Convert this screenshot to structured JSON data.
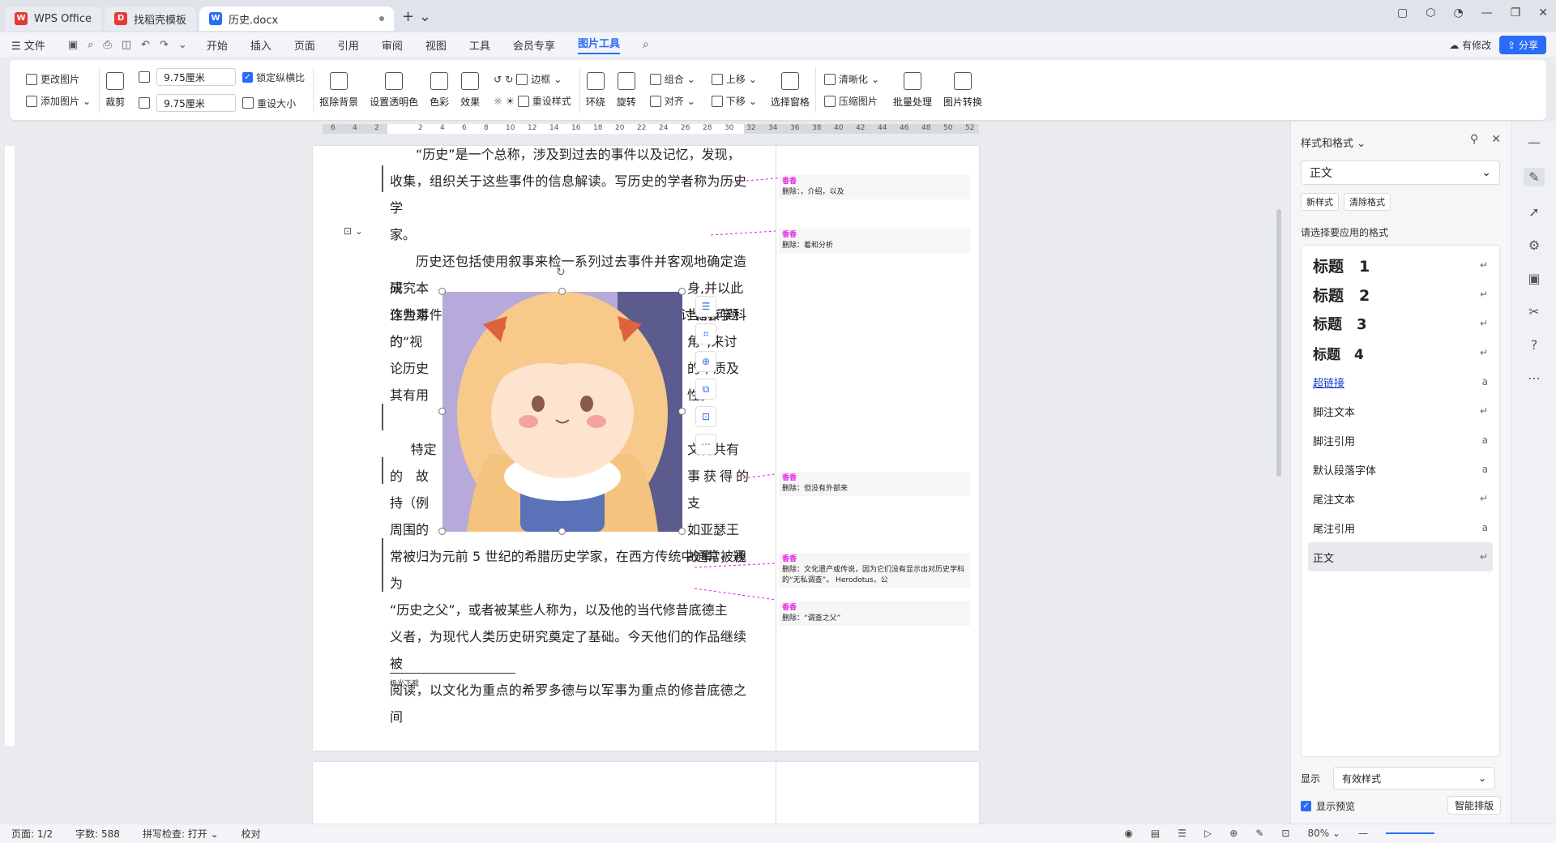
{
  "tabs": [
    {
      "label": "WPS Office",
      "icon": "wps-logo-icon"
    },
    {
      "label": "找稻壳模板",
      "icon": "template-logo-icon"
    },
    {
      "label": "历史.docx",
      "icon": "word-doc-icon"
    }
  ],
  "menu": {
    "file": "文件",
    "items": [
      "开始",
      "插入",
      "页面",
      "引用",
      "审阅",
      "视图",
      "工具",
      "会员专享",
      "图片工具"
    ],
    "active": "图片工具",
    "modify": "有修改",
    "share": "分享"
  },
  "ribbon": {
    "change_image": "更改图片",
    "add_image": "添加图片",
    "crop": "裁剪",
    "height_value": "9.75厘米",
    "width_value": "9.75厘米",
    "lock_ratio": "锁定纵横比",
    "reset_size": "重设大小",
    "remove_bg": "抠除背景",
    "set_transparent": "设置透明色",
    "color": "色彩",
    "effects": "效果",
    "border": "边框",
    "reset_style": "重设样式",
    "wrap": "环绕",
    "rotate": "旋转",
    "group": "组合",
    "align": "对齐",
    "bring_up": "上移",
    "send_down": "下移",
    "selection_pane": "选择窗格",
    "sharpen": "清晰化",
    "compress": "压缩图片",
    "batch": "批量处理",
    "convert": "图片转换"
  },
  "ruler_ticks": [
    "6",
    "4",
    "2",
    "",
    "2",
    "4",
    "6",
    "8",
    "10",
    "12",
    "14",
    "16",
    "18",
    "20",
    "22",
    "24",
    "26",
    "28",
    "30",
    "32",
    "34",
    "36",
    "38",
    "40",
    "42",
    "44",
    "46",
    "48",
    "50",
    "52"
  ],
  "document": {
    "para1_line1": "“历史”是一个总称，涉及到过去的事件以及记忆，发现，",
    "para1_line2": "收集，组织关于这些事件的信息解读。写历史的学者称为历史学",
    "para1_line3": "家。",
    "para2_line1": "历史还包括使用叙事来检一系列过去事件并客观地确定造成",
    "para2_line2": "这些事件的因果关系的学科。历史学家有时会通过讨论该学科的",
    "wrap_left": [
      "研究本",
      "作为对",
      "的“视",
      "论历史",
      "其有用"
    ],
    "wrap_right": [
      "身,并以此",
      "当前问题",
      "角”,来讨",
      "的本质及",
      "性。"
    ],
    "para3_left": [
      "特定",
      "的　故",
      "持（例",
      "周围的"
    ],
    "para3_right": [
      "文化共有",
      "事获得的支",
      "如亚瑟王",
      "故事），通"
    ],
    "para3_line5": "常被归为元前 5 世纪的希腊历史学家，在西方传统中通常被视为",
    "para3_line6": "“历史之父”，或者被某些人称为，以及他的当代修昔底德主",
    "para3_line7": "义者，为现代人类历史研究奠定了基础。今天他们的作品继续被",
    "para3_line8": "阅读，以文化为重点的希罗多德与以军事为重点的修昔底德之间",
    "footnote": "极光下载"
  },
  "comments": [
    {
      "author": "香香",
      "text": "删除：，介绍，以及"
    },
    {
      "author": "香香",
      "text": "删除：着和分析"
    },
    {
      "author": "香香",
      "text": "删除：但没有外部来"
    },
    {
      "author": "香香",
      "text": "删除：文化遗产或传说，因为它们没有显示出对历史学科的“无私调查”。 Herodotus，公"
    },
    {
      "author": "香香",
      "text": "删除：“调查之父”"
    }
  ],
  "panel": {
    "title": "样式和格式",
    "current_style": "正文",
    "new_style": "新样式",
    "clear_format": "清除格式",
    "hint": "请选择要应用的格式",
    "styles": [
      {
        "label": "标题　1",
        "mark": "↵"
      },
      {
        "label": "标题　2",
        "mark": "↵"
      },
      {
        "label": "标题　3",
        "mark": "↵"
      },
      {
        "label": "标题　4",
        "mark": "↵"
      },
      {
        "label": "超链接",
        "mark": "a"
      },
      {
        "label": "脚注文本",
        "mark": "↵"
      },
      {
        "label": "脚注引用",
        "mark": "a"
      },
      {
        "label": "默认段落字体",
        "mark": "a"
      },
      {
        "label": "尾注文本",
        "mark": "↵"
      },
      {
        "label": "尾注引用",
        "mark": "a"
      },
      {
        "label": "正文",
        "mark": "↵"
      }
    ],
    "show_label": "显示",
    "show_value": "有效样式",
    "preview": "显示预览",
    "smart": "智能排版"
  },
  "status": {
    "page": "页面: 1/2",
    "words": "字数: 588",
    "spell": "拼写检查: 打开",
    "proof": "校对",
    "zoom": "80%"
  },
  "colors": {
    "accent": "#2b6cf6",
    "comment_author": "#e020e0"
  }
}
